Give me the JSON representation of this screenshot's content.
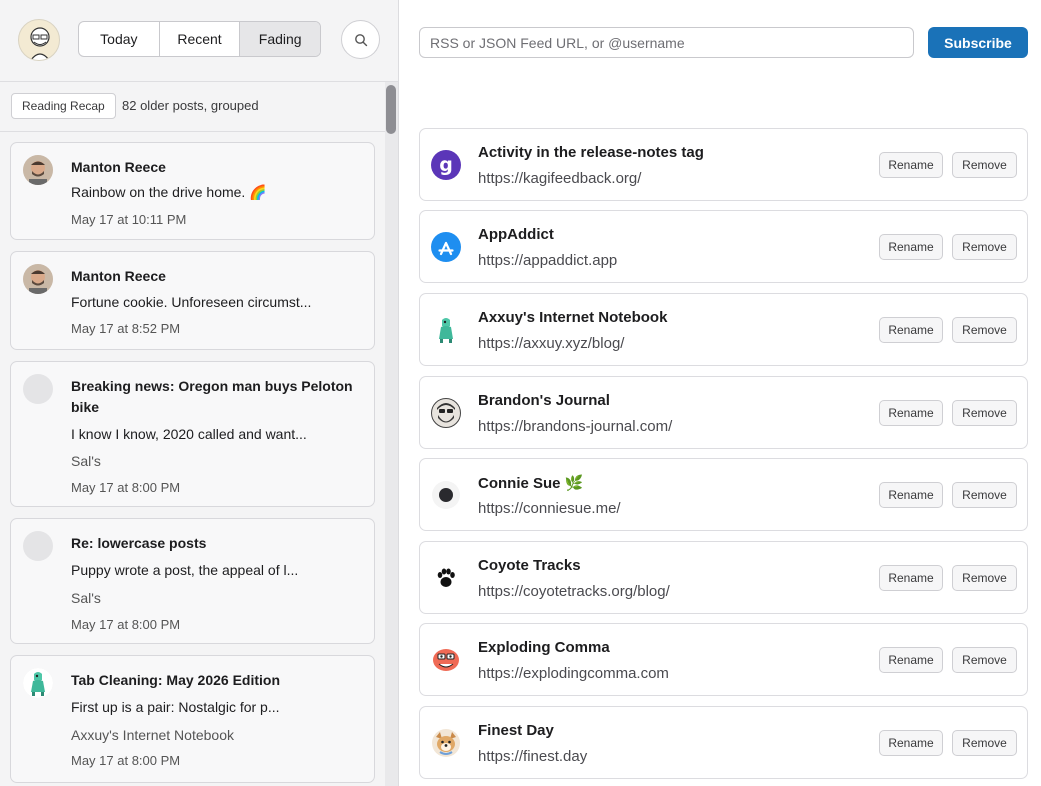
{
  "tabs": {
    "today": "Today",
    "recent": "Recent",
    "fading": "Fading"
  },
  "recap": {
    "button": "Reading Recap",
    "summary": "82 older posts, grouped"
  },
  "posts": [
    {
      "title": "Manton Reece",
      "text": "Rainbow on the drive home. 🌈",
      "source": "",
      "date": "May 17 at 10:11 PM"
    },
    {
      "title": "Manton Reece",
      "text": "Fortune cookie. Unforeseen circumst...",
      "source": "",
      "date": "May 17 at 8:52 PM"
    },
    {
      "title": "Breaking news: Oregon man buys Peloton bike",
      "text": "I know I know, 2020 called and want...",
      "source": "Sal's",
      "date": "May 17 at 8:00 PM"
    },
    {
      "title": "Re: lowercase posts",
      "text": "Puppy wrote a post, the appeal of l...",
      "source": "Sal's",
      "date": "May 17 at 8:00 PM"
    },
    {
      "title": "Tab Cleaning: May 2026 Edition",
      "text": "First up is a pair: Nostalgic for p...",
      "source": "Axxuy's Internet Notebook",
      "date": "May 17 at 8:00 PM"
    }
  ],
  "subscribe": {
    "placeholder": "RSS or JSON Feed URL, or @username",
    "button": "Subscribe"
  },
  "feed_actions": {
    "rename": "Rename",
    "remove": "Remove"
  },
  "feeds": [
    {
      "name": "Activity in the release-notes tag",
      "url": "https://kagifeedback.org/",
      "icon": "kagi-g-icon"
    },
    {
      "name": "AppAddict",
      "url": "https://appaddict.app",
      "icon": "app-store-icon"
    },
    {
      "name": "Axxuy's Internet Notebook",
      "url": "https://axxuy.xyz/blog/",
      "icon": "green-creature-icon"
    },
    {
      "name": "Brandon's Journal",
      "url": "https://brandons-journal.com/",
      "icon": "bearded-face-icon"
    },
    {
      "name": "Connie Sue 🌿",
      "url": "https://conniesue.me/",
      "icon": "dark-dot-icon"
    },
    {
      "name": "Coyote Tracks",
      "url": "https://coyotetracks.org/blog/",
      "icon": "paw-print-icon"
    },
    {
      "name": "Exploding Comma",
      "url": "https://explodingcomma.com",
      "icon": "red-face-icon"
    },
    {
      "name": "Finest Day",
      "url": "https://finest.day",
      "icon": "dog-face-icon"
    }
  ],
  "colors": {
    "accent": "#1a72b8",
    "kagi": "#5b36b8",
    "appstore": "#1e8ef0"
  }
}
